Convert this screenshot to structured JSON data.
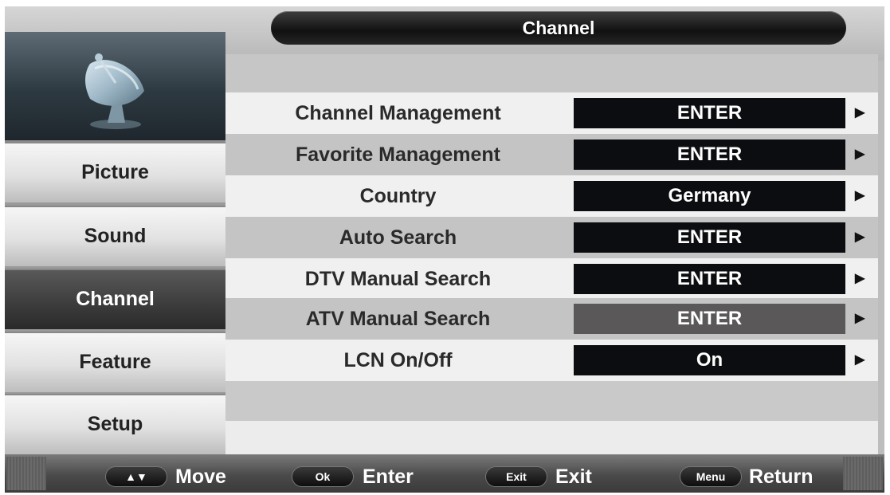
{
  "header": {
    "title": "Channel"
  },
  "sidebar": {
    "image_icon": "satellite-dish-icon",
    "items": [
      {
        "label": "Picture",
        "active": false
      },
      {
        "label": "Sound",
        "active": false
      },
      {
        "label": "Channel",
        "active": true
      },
      {
        "label": "Feature",
        "active": false
      },
      {
        "label": "Setup",
        "active": false
      }
    ]
  },
  "menu": {
    "rows": [
      {
        "label": "Channel Management",
        "value": "ENTER"
      },
      {
        "label": "Favorite Management",
        "value": "ENTER"
      },
      {
        "label": "Country",
        "value": "Germany"
      },
      {
        "label": "Auto Search",
        "value": "ENTER"
      },
      {
        "label": "DTV Manual Search",
        "value": "ENTER"
      },
      {
        "label": "ATV Manual Search",
        "value": "ENTER",
        "selected": true
      },
      {
        "label": "LCN On/Off",
        "value": "On"
      }
    ],
    "arrow_icon": "triangle-right-icon"
  },
  "footer": {
    "move": {
      "key": "▲▼",
      "label": "Move"
    },
    "enter": {
      "key": "Ok",
      "label": "Enter"
    },
    "exit": {
      "key": "Exit",
      "label": "Exit"
    },
    "return": {
      "key": "Menu",
      "label": "Return"
    }
  },
  "colors": {
    "value_box": "#0c0d10",
    "value_box_selected": "#5a5858",
    "active_tab": "#3b3b3b",
    "title_bar": "#111111"
  }
}
